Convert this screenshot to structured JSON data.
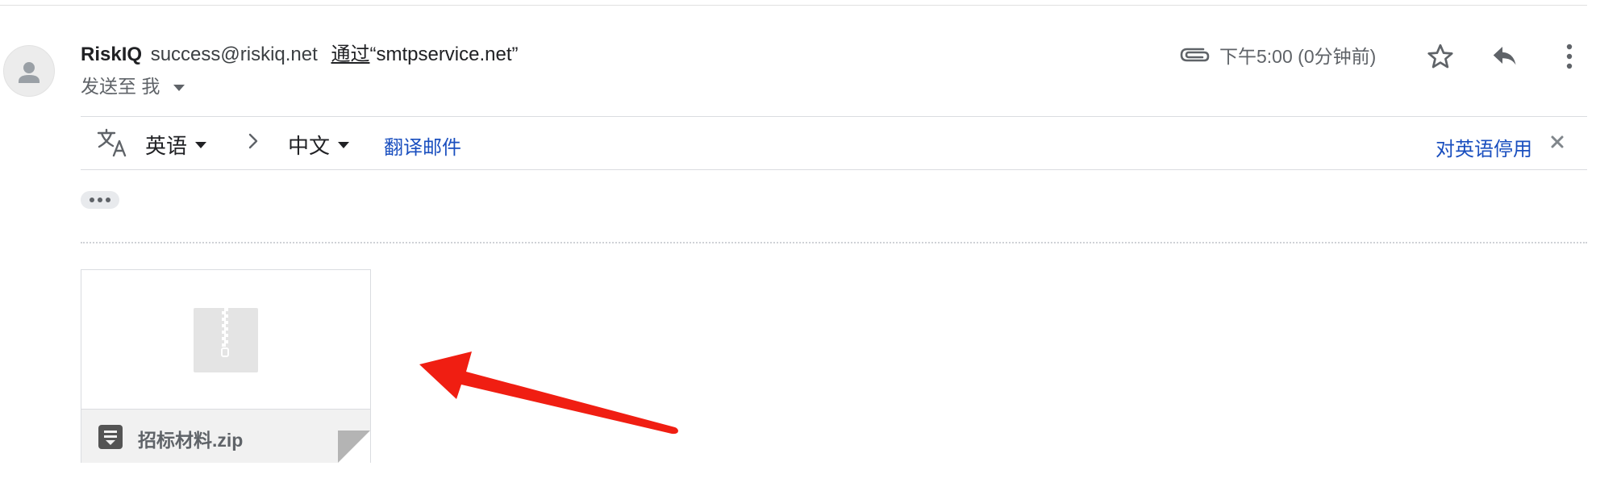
{
  "message": {
    "sender_name": "RiskIQ",
    "sender_email": "success@riskiq.net",
    "via_label": "通过",
    "via_domain": "“smtpservice.net”",
    "to_prefix": "发送至",
    "to_recipient": "我",
    "time": "下午5:00 (0分钟前)",
    "has_attachment": true,
    "starred": false
  },
  "icons": {
    "avatar": "person-silhouette",
    "attachment_indicator": "paperclip-icon",
    "star": "star-outline-icon",
    "reply": "reply-icon",
    "more": "more-vert-icon",
    "translate": "translate-icon",
    "zip": "zip-file-icon",
    "file": "document-icon",
    "close": "close-x-icon",
    "annotation": "red-arrow"
  },
  "translate_bar": {
    "source_lang": "英语",
    "target_lang": "中文",
    "translate_action": "翻译邮件",
    "disable_action": "对英语停用"
  },
  "attachment": {
    "file_name": "招标材料.zip"
  },
  "colors": {
    "link_blue": "#1a4fbf",
    "annotation_red": "#f01e12",
    "text_primary": "#202124",
    "text_secondary": "#5f6368"
  }
}
